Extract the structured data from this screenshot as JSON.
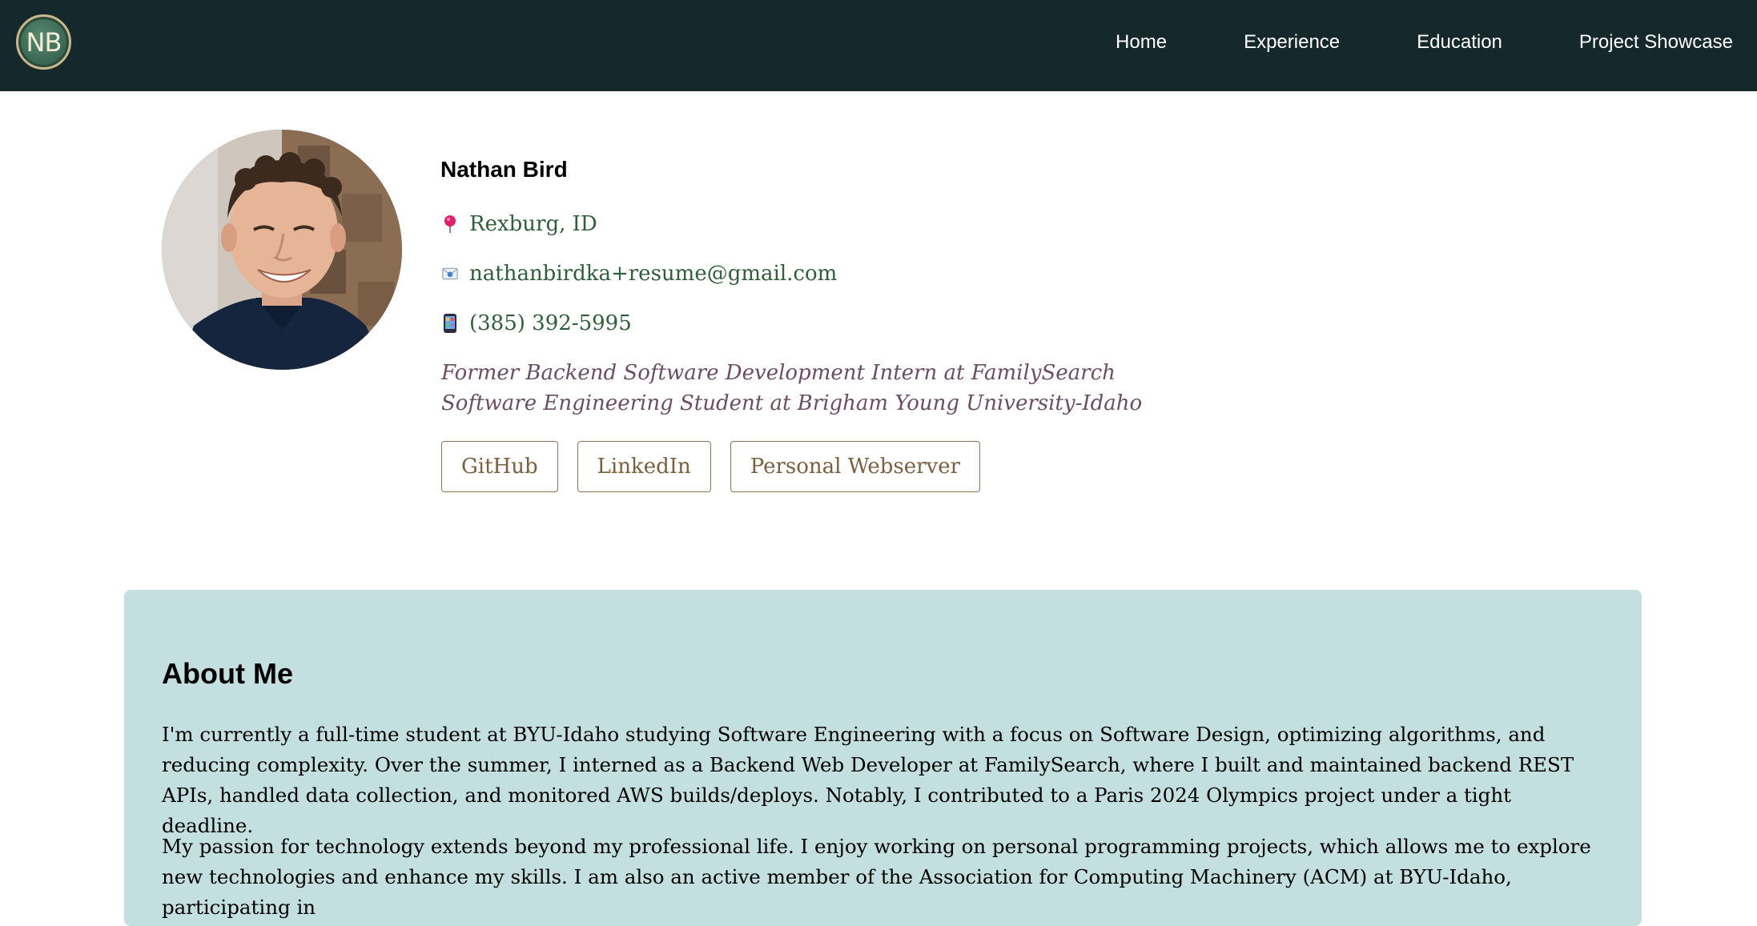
{
  "nav": {
    "logo_text": "NB",
    "links": [
      "Home",
      "Experience",
      "Education",
      "Project Showcase"
    ]
  },
  "profile": {
    "name": "Nathan Bird",
    "location": "Rexburg, ID",
    "email": "nathanbirdka+resume@gmail.com",
    "phone": "(385) 392-5995",
    "subtitle_lines": [
      "Former Backend Software Development Intern at FamilySearch",
      "Software Engineering Student at Brigham Young University-Idaho"
    ],
    "buttons": [
      "GitHub",
      "LinkedIn",
      "Personal Webserver"
    ],
    "icons": {
      "location": "pushpin-icon",
      "email": "envelope-icon",
      "phone": "mobile-phone-icon"
    }
  },
  "about": {
    "title": "About Me",
    "paragraphs": [
      "I'm currently a full-time student at BYU-Idaho studying Software Engineering with a focus on Software Design, optimizing algorithms, and reducing complexity. Over the summer, I interned as a Backend Web Developer at FamilySearch, where I built and maintained backend REST APIs, handled data collection, and monitored AWS builds/deploys. Notably, I contributed to a Paris 2024 Olympics project under a tight deadline.",
      "My passion for technology extends beyond my professional life. I enjoy working on personal programming projects, which allows me to explore new technologies and enhance my skills. I am also an active member of the Association for Computing Machinery (ACM) at BYU-Idaho, participating in"
    ]
  },
  "colors": {
    "nav_bg": "#15282b",
    "contact_text": "#2f5e3a",
    "subtitle_text": "#6b4d66",
    "button_text": "#7a6040",
    "about_bg": "#c3dfe0"
  }
}
